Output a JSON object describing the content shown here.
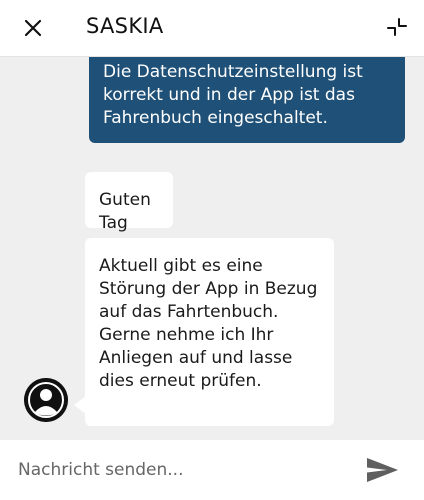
{
  "header": {
    "title": "SASKIA",
    "close_icon": "close-icon",
    "minimize_icon": "minimize-icon"
  },
  "messages": [
    {
      "sender": "user",
      "text": "Die Datenschutzeinstellung ist korrekt und in der App ist das Fahrenbuch eingeschaltet."
    },
    {
      "sender": "agent",
      "text": "Guten Tag"
    },
    {
      "sender": "agent",
      "text": "Aktuell gibt es eine Störung der App in Bezug auf das Fahrtenbuch. Gerne nehme ich Ihr Anliegen auf und lasse dies erneut prüfen."
    }
  ],
  "composer": {
    "placeholder": "Nachricht senden...",
    "value": "",
    "send_icon": "send-icon"
  },
  "colors": {
    "user_bubble": "#1f5077",
    "agent_bubble": "#ffffff",
    "chat_background": "#efefef",
    "send_icon": "#5f5f5f"
  }
}
